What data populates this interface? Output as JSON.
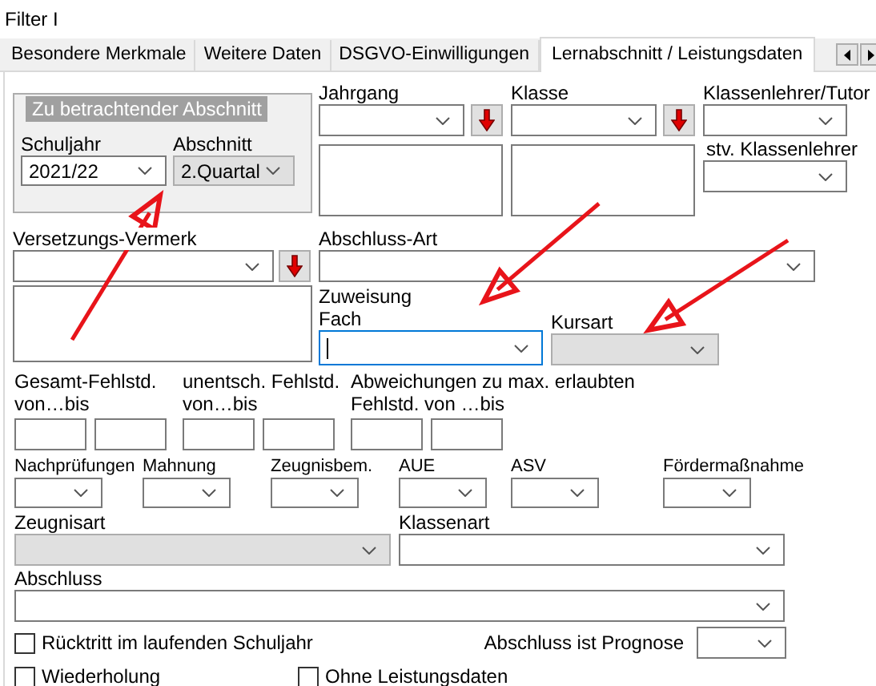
{
  "window": {
    "title": "Filter I"
  },
  "tabs": [
    {
      "label": "Besondere Merkmale",
      "selected": false
    },
    {
      "label": "Weitere Daten",
      "selected": false
    },
    {
      "label": "DSGVO-Einwilligungen",
      "selected": false
    },
    {
      "label": "Lernabschnitt / Leistungsdaten",
      "selected": true
    }
  ],
  "period_group": {
    "legend": "Zu betrachtender Abschnitt",
    "fields": [
      {
        "label": "Schuljahr",
        "value": "2021/22",
        "disabled": false
      },
      {
        "label": "Abschnitt",
        "value": "2.Quartal",
        "disabled": true
      }
    ]
  },
  "jahrgang": {
    "label": "Jahrgang",
    "disabled": false
  },
  "klasse": {
    "label": "Klasse",
    "disabled": false
  },
  "klassenlehrer": {
    "label": "Klassenlehrer/Tutor",
    "disabled": false
  },
  "stv_klassenlehrer": {
    "label": "stv. Klassenlehrer",
    "disabled": false
  },
  "versetzungs_vermerk": {
    "label": "Versetzungs-Vermerk",
    "disabled": false
  },
  "abschluss_art": {
    "label": "Abschluss-Art",
    "disabled": false
  },
  "zuweisung": {
    "label": "Zuweisung"
  },
  "fach": {
    "label": "Fach",
    "disabled": false,
    "focused": true
  },
  "kursart": {
    "label": "Kursart",
    "disabled": true
  },
  "fehlstunden": [
    {
      "lines": [
        "Gesamt-Fehlstd.",
        "von…bis"
      ]
    },
    {
      "lines": [
        "unentsch. Fehlstd.",
        "von…bis"
      ]
    },
    {
      "lines": [
        "Abweichungen zu max. erlaubten",
        "Fehlstd. von …bis"
      ]
    }
  ],
  "small_combos": [
    {
      "label": "Nachprüfungen",
      "disabled": false
    },
    {
      "label": "Mahnung",
      "disabled": false
    },
    {
      "label": "Zeugnisbem.",
      "disabled": false
    },
    {
      "label": "AUE",
      "disabled": false
    },
    {
      "label": "ASV",
      "disabled": false
    },
    {
      "label": "Fördermaßnahme",
      "disabled": false
    }
  ],
  "zeugnisart": {
    "label": "Zeugnisart",
    "disabled": true
  },
  "klassenart": {
    "label": "Klassenart",
    "disabled": false
  },
  "abschluss": {
    "label": "Abschluss",
    "disabled": false
  },
  "checkboxes": [
    {
      "label": "Rücktritt im laufenden Schuljahr",
      "checked": false
    },
    {
      "label": "Wiederholung",
      "checked": false
    },
    {
      "label": "Ohne Leistungsdaten",
      "checked": false
    }
  ],
  "prognose": {
    "label": "Abschluss ist Prognose",
    "disabled": false
  }
}
